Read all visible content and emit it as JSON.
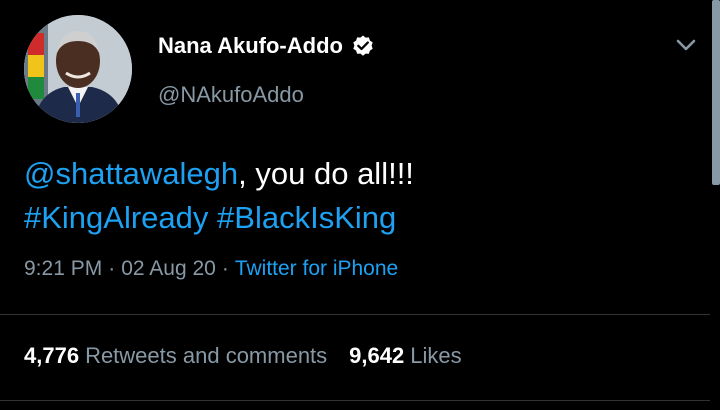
{
  "author": {
    "display_name": "Nana Akufo-Addo",
    "handle": "@NAkufoAddo",
    "verified": true
  },
  "tweet": {
    "mention": "@shattawalegh",
    "text_after_mention": ", you do all!!!",
    "hashtag_1": "#KingAlready",
    "hashtag_2": "#BlackIsKing",
    "time": "9:21 PM",
    "separator": "·",
    "date": "02 Aug 20",
    "source": "Twitter for iPhone"
  },
  "stats": {
    "retweets_count": "4,776",
    "retweets_label": "Retweets and comments",
    "likes_count": "9,642",
    "likes_label": "Likes"
  },
  "colors": {
    "background": "#000000",
    "text": "#ffffff",
    "secondary": "#8899a6",
    "link": "#1da1f2",
    "verified_badge": "#ffffff"
  },
  "icons": {
    "verified": "verified-badge-icon",
    "more": "chevron-down-icon"
  }
}
